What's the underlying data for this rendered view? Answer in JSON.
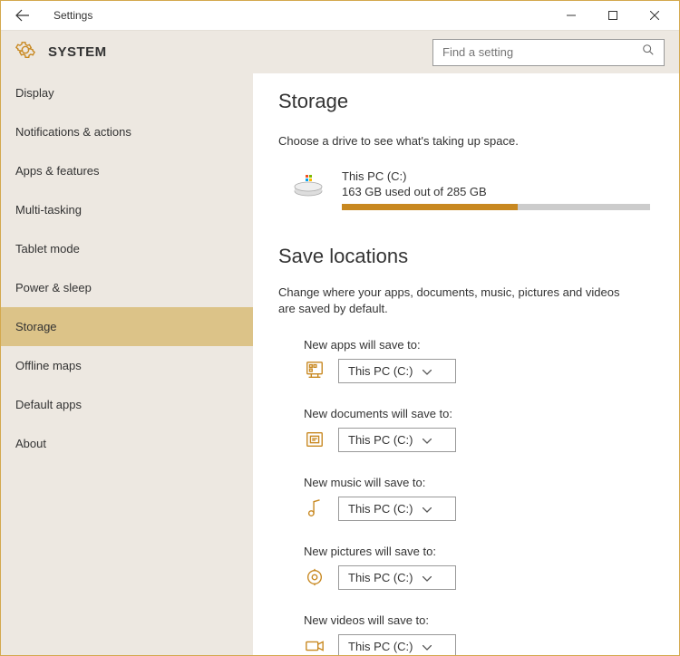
{
  "titlebar": {
    "title": "Settings"
  },
  "header": {
    "title": "SYSTEM",
    "search_placeholder": "Find a setting"
  },
  "sidebar": {
    "items": [
      {
        "label": "Display"
      },
      {
        "label": "Notifications & actions"
      },
      {
        "label": "Apps & features"
      },
      {
        "label": "Multi-tasking"
      },
      {
        "label": "Tablet mode"
      },
      {
        "label": "Power & sleep"
      },
      {
        "label": "Storage"
      },
      {
        "label": "Offline maps"
      },
      {
        "label": "Default apps"
      },
      {
        "label": "About"
      }
    ],
    "active_index": 6
  },
  "storage": {
    "page_title": "Storage",
    "subtext": "Choose a drive to see what's taking up space.",
    "drive": {
      "name": "This PC (C:)",
      "usage_text": "163 GB used out of 285 GB",
      "used_gb": 163,
      "total_gb": 285,
      "percent": 57
    }
  },
  "save_locations": {
    "title": "Save locations",
    "subtext": "Change where your apps, documents, music, pictures and videos are saved by default.",
    "items": [
      {
        "label": "New apps will save to:",
        "value": "This PC (C:)",
        "icon": "apps"
      },
      {
        "label": "New documents will save to:",
        "value": "This PC (C:)",
        "icon": "documents"
      },
      {
        "label": "New music will save to:",
        "value": "This PC (C:)",
        "icon": "music"
      },
      {
        "label": "New pictures will save to:",
        "value": "This PC (C:)",
        "icon": "pictures"
      },
      {
        "label": "New videos will save to:",
        "value": "This PC (C:)",
        "icon": "videos"
      }
    ]
  },
  "colors": {
    "accent": "#c88820",
    "sidebar_bg": "#ede8e1",
    "active_bg": "#dcc388"
  }
}
